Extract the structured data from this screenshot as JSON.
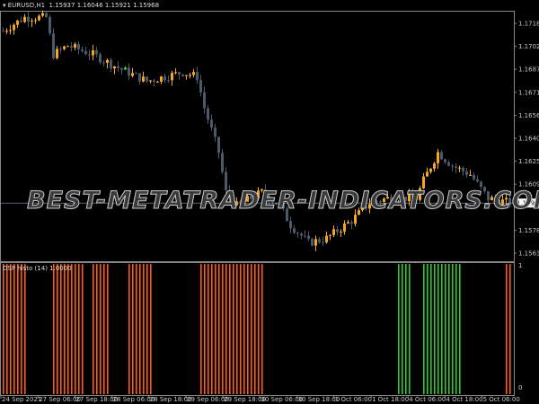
{
  "chart_title": {
    "symbol": "EURUSD,H1",
    "open": "1.15937",
    "high": "1.16046",
    "low": "1.15921",
    "close": "1.15968"
  },
  "indicator_title": "DSP histo (14) 1.0000",
  "watermark": "BEST-METATRADER-INDICATORS.COM",
  "colors": {
    "bull": "#f5a623",
    "bear": "#4a5a6a",
    "up_hist": "#2ecc2e",
    "down_hist": "#ff5a10",
    "axis": "#888888",
    "bid_line": "#8a9bb0"
  },
  "chart_data": {
    "type": "candlestick",
    "price_axis": [
      "1.17180",
      "1.17025",
      "1.16870",
      "1.16715",
      "1.16560",
      "1.16405",
      "1.16250",
      "1.16095",
      "1.15785",
      "1.15630"
    ],
    "current_price": "1.15968",
    "ylim": [
      1.155,
      1.1732
    ],
    "price_path": [
      [
        0,
        1.1713
      ],
      [
        6,
        1.1722
      ],
      [
        12,
        1.1722
      ],
      [
        14,
        1.1697
      ],
      [
        18,
        1.1703
      ],
      [
        25,
        1.1697
      ],
      [
        32,
        1.1688
      ],
      [
        40,
        1.1679
      ],
      [
        50,
        1.1685
      ],
      [
        54,
        1.1682
      ],
      [
        56,
        1.1661
      ],
      [
        60,
        1.1631
      ],
      [
        62,
        1.1604
      ],
      [
        65,
        1.1595
      ],
      [
        72,
        1.1604
      ],
      [
        77,
        1.1595
      ],
      [
        80,
        1.1582
      ],
      [
        85,
        1.157
      ],
      [
        90,
        1.1573
      ],
      [
        97,
        1.1585
      ],
      [
        102,
        1.1597
      ],
      [
        107,
        1.16
      ],
      [
        115,
        1.16
      ],
      [
        117,
        1.1612
      ],
      [
        121,
        1.1631
      ],
      [
        125,
        1.1622
      ],
      [
        130,
        1.1616
      ],
      [
        135,
        1.16
      ],
      [
        141,
        1.1597
      ]
    ],
    "bar_count": 142,
    "time_axis": [
      "24 Sep 2021",
      "27 Sep 06:00",
      "27 Sep 18:00",
      "28 Sep 06:00",
      "28 Sep 18:00",
      "29 Sep 06:00",
      "29 Sep 18:00",
      "30 Sep 06:00",
      "30 Sep 18:00",
      "1 Oct 06:00",
      "1 Oct 18:00",
      "4 Oct 06:00",
      "4 Oct 18:00",
      "5 Oct 06:00"
    ],
    "indicator": {
      "name": "DSP histo (14)",
      "ylim": [
        0,
        1
      ],
      "axis": [
        "1",
        "0"
      ],
      "down_ranges": [
        [
          0,
          6
        ],
        [
          14,
          22
        ],
        [
          25,
          29
        ],
        [
          35,
          40
        ],
        [
          41,
          41
        ],
        [
          55,
          72
        ],
        [
          140,
          141
        ]
      ],
      "up_ranges": [
        [
          110,
          113
        ],
        [
          117,
          127
        ]
      ]
    }
  }
}
